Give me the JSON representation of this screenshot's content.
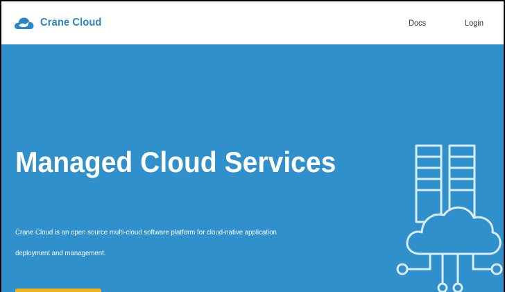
{
  "brand": {
    "name": "Crane Cloud",
    "icon": "crane-cloud-logo-icon"
  },
  "nav": {
    "docs_label": "Docs",
    "login_label": "Login"
  },
  "hero": {
    "title": "Managed Cloud Services",
    "description": "Crane Cloud is an open source multi-cloud software platform for cloud-native application deployment and management.",
    "cta_label": "",
    "illustration_icon": "cloud-server-network-icon"
  },
  "colors": {
    "brand": "#2b86c7",
    "hero_background": "#3090cc",
    "cta": "#f2b21c",
    "navbar_background": "#ffffff"
  }
}
